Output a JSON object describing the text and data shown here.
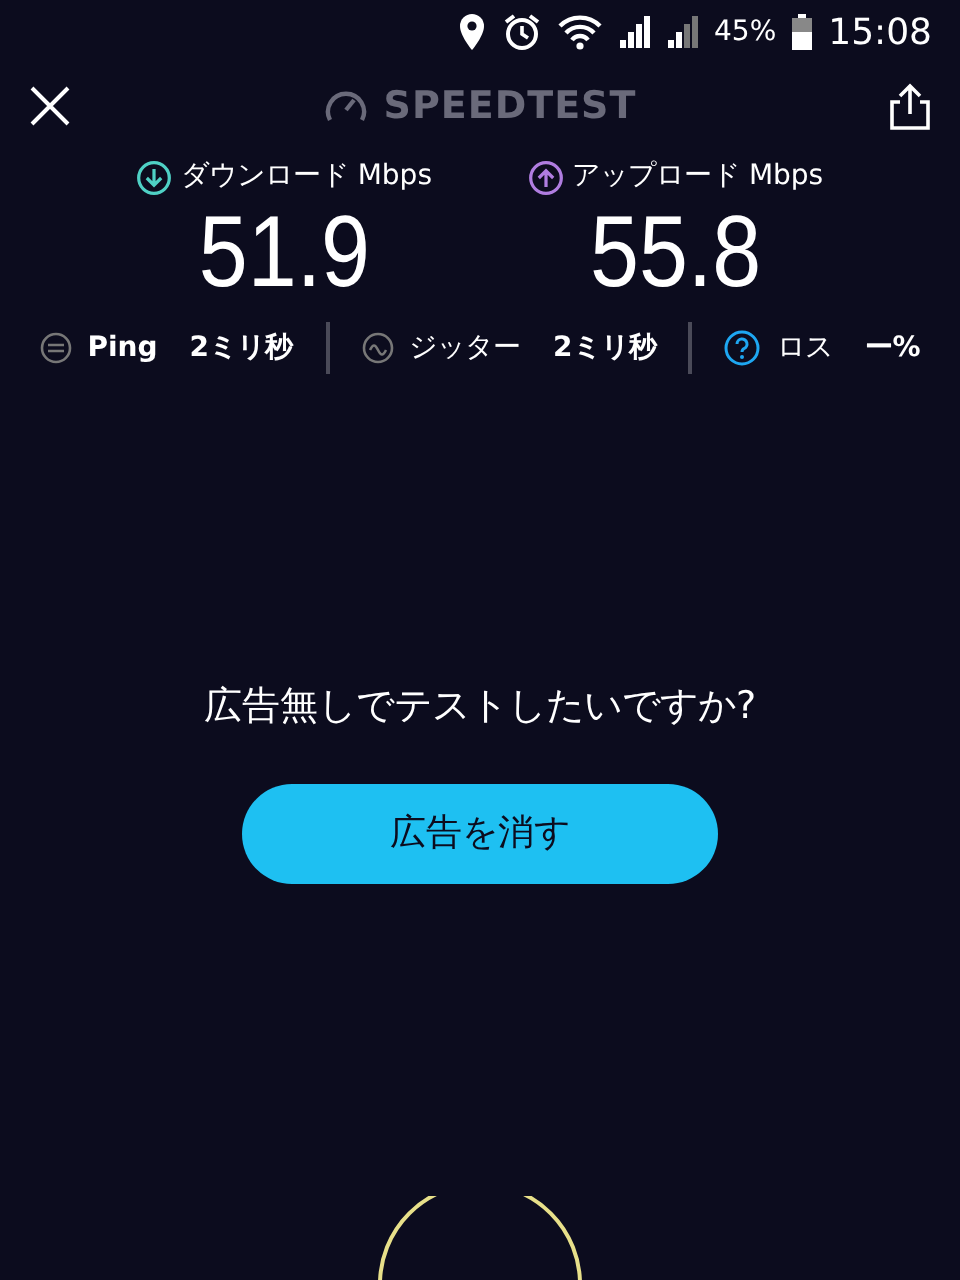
{
  "status_bar": {
    "battery": "45%",
    "time": "15:08"
  },
  "header": {
    "title": "SPEEDTEST"
  },
  "speeds": [
    {
      "kind": "download",
      "label": "ダウンロード Mbps",
      "value": "51.9",
      "color": "#4fd1c5"
    },
    {
      "kind": "upload",
      "label": "アップロード Mbps",
      "value": "55.8",
      "color": "#b07de0"
    }
  ],
  "stats": [
    {
      "kind": "ping",
      "label": "Ping",
      "value": "2ミリ秒"
    },
    {
      "kind": "jitter",
      "label": "ジッター",
      "value": "2ミリ秒"
    },
    {
      "kind": "loss",
      "label": "ロス",
      "value": "ー%"
    }
  ],
  "ad_prompt": {
    "question": "広告無しでテストしたいですか?",
    "button": "広告を消す"
  }
}
